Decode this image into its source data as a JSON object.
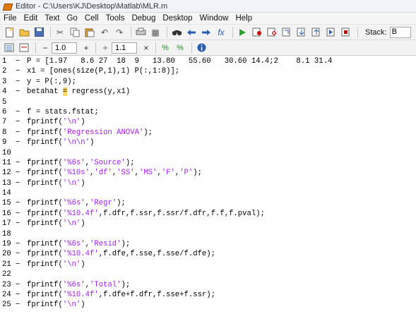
{
  "window": {
    "title": "Editor - C:\\Users\\KJ\\Desktop\\Matlab\\MLR.m"
  },
  "menu": [
    "File",
    "Edit",
    "Text",
    "Go",
    "Cell",
    "Tools",
    "Debug",
    "Desktop",
    "Window",
    "Help"
  ],
  "toolbar": {
    "stack_label": "Stack:",
    "stack_value": "B"
  },
  "cellbar": {
    "decrement": "−",
    "value1": "1.0",
    "increment": "+",
    "divide": "÷",
    "value2": "1.1",
    "times": "×"
  },
  "lines": [
    {
      "n": "1",
      "d": "−",
      "parts": [
        {
          "t": "P = [1.97   8.6 27  18  9   13.80   55.60   30.60 14.4;2    8.1 31.4"
        }
      ]
    },
    {
      "n": "2",
      "d": "−",
      "parts": [
        {
          "t": "x1 = [ones(size(P,1),1) P(:,1:8)];"
        }
      ]
    },
    {
      "n": "3",
      "d": "−",
      "parts": [
        {
          "t": "y = P(:,9);"
        }
      ]
    },
    {
      "n": "4",
      "d": "−",
      "parts": [
        {
          "t": "betahat "
        },
        {
          "t": "=",
          "w": 1
        },
        {
          "t": " regress(y,x1)"
        }
      ]
    },
    {
      "n": "5",
      "d": "",
      "parts": []
    },
    {
      "n": "6",
      "d": "−",
      "parts": [
        {
          "t": "f = stats.fstat;"
        }
      ]
    },
    {
      "n": "7",
      "d": "−",
      "parts": [
        {
          "t": "fprintf("
        },
        {
          "t": "'\\n'",
          "s": 1
        },
        {
          "t": ")"
        }
      ]
    },
    {
      "n": "8",
      "d": "−",
      "parts": [
        {
          "t": "fprintf("
        },
        {
          "t": "'Regression ANOVA'",
          "s": 1
        },
        {
          "t": ");"
        }
      ]
    },
    {
      "n": "9",
      "d": "−",
      "parts": [
        {
          "t": "fprintf("
        },
        {
          "t": "'\\n\\n'",
          "s": 1
        },
        {
          "t": ")"
        }
      ]
    },
    {
      "n": "10",
      "d": "",
      "parts": []
    },
    {
      "n": "11",
      "d": "−",
      "parts": [
        {
          "t": "fprintf("
        },
        {
          "t": "'%6s'",
          "s": 1
        },
        {
          "t": ","
        },
        {
          "t": "'Source'",
          "s": 1
        },
        {
          "t": ");"
        }
      ]
    },
    {
      "n": "12",
      "d": "−",
      "parts": [
        {
          "t": "fprintf("
        },
        {
          "t": "'%10s'",
          "s": 1
        },
        {
          "t": ","
        },
        {
          "t": "'df'",
          "s": 1
        },
        {
          "t": ","
        },
        {
          "t": "'SS'",
          "s": 1
        },
        {
          "t": ","
        },
        {
          "t": "'MS'",
          "s": 1
        },
        {
          "t": ","
        },
        {
          "t": "'F'",
          "s": 1
        },
        {
          "t": ","
        },
        {
          "t": "'P'",
          "s": 1
        },
        {
          "t": ");"
        }
      ]
    },
    {
      "n": "13",
      "d": "−",
      "parts": [
        {
          "t": "fprintf("
        },
        {
          "t": "'\\n'",
          "s": 1
        },
        {
          "t": ")"
        }
      ]
    },
    {
      "n": "14",
      "d": "",
      "parts": []
    },
    {
      "n": "15",
      "d": "−",
      "parts": [
        {
          "t": "fprintf("
        },
        {
          "t": "'%6s'",
          "s": 1
        },
        {
          "t": ","
        },
        {
          "t": "'Regr'",
          "s": 1
        },
        {
          "t": ");"
        }
      ]
    },
    {
      "n": "16",
      "d": "−",
      "parts": [
        {
          "t": "fprintf("
        },
        {
          "t": "'%10.4f'",
          "s": 1
        },
        {
          "t": ",f.dfr,f.ssr,f.ssr/f.dfr,f.f,f.pval);"
        }
      ]
    },
    {
      "n": "17",
      "d": "−",
      "parts": [
        {
          "t": "fprintf("
        },
        {
          "t": "'\\n'",
          "s": 1
        },
        {
          "t": ")"
        }
      ]
    },
    {
      "n": "18",
      "d": "",
      "parts": []
    },
    {
      "n": "19",
      "d": "−",
      "parts": [
        {
          "t": "fprintf("
        },
        {
          "t": "'%6s'",
          "s": 1
        },
        {
          "t": ","
        },
        {
          "t": "'Resid'",
          "s": 1
        },
        {
          "t": ");"
        }
      ]
    },
    {
      "n": "20",
      "d": "−",
      "parts": [
        {
          "t": "fprintf("
        },
        {
          "t": "'%10.4f'",
          "s": 1
        },
        {
          "t": ",f.dfe,f.sse,f.sse/f.dfe);"
        }
      ]
    },
    {
      "n": "21",
      "d": "−",
      "parts": [
        {
          "t": "fprintf("
        },
        {
          "t": "'\\n'",
          "s": 1
        },
        {
          "t": ")"
        }
      ]
    },
    {
      "n": "22",
      "d": "",
      "parts": []
    },
    {
      "n": "23",
      "d": "−",
      "parts": [
        {
          "t": "fprintf("
        },
        {
          "t": "'%6s'",
          "s": 1
        },
        {
          "t": ","
        },
        {
          "t": "'Total'",
          "s": 1
        },
        {
          "t": ");"
        }
      ]
    },
    {
      "n": "24",
      "d": "−",
      "parts": [
        {
          "t": "fprintf("
        },
        {
          "t": "'%10.4f'",
          "s": 1
        },
        {
          "t": ",f.dfe+f.dfr,f.sse+f.ssr);"
        }
      ]
    },
    {
      "n": "25",
      "d": "−",
      "parts": [
        {
          "t": "fprintf("
        },
        {
          "t": "'\\n'",
          "s": 1
        },
        {
          "t": ")"
        }
      ]
    }
  ]
}
